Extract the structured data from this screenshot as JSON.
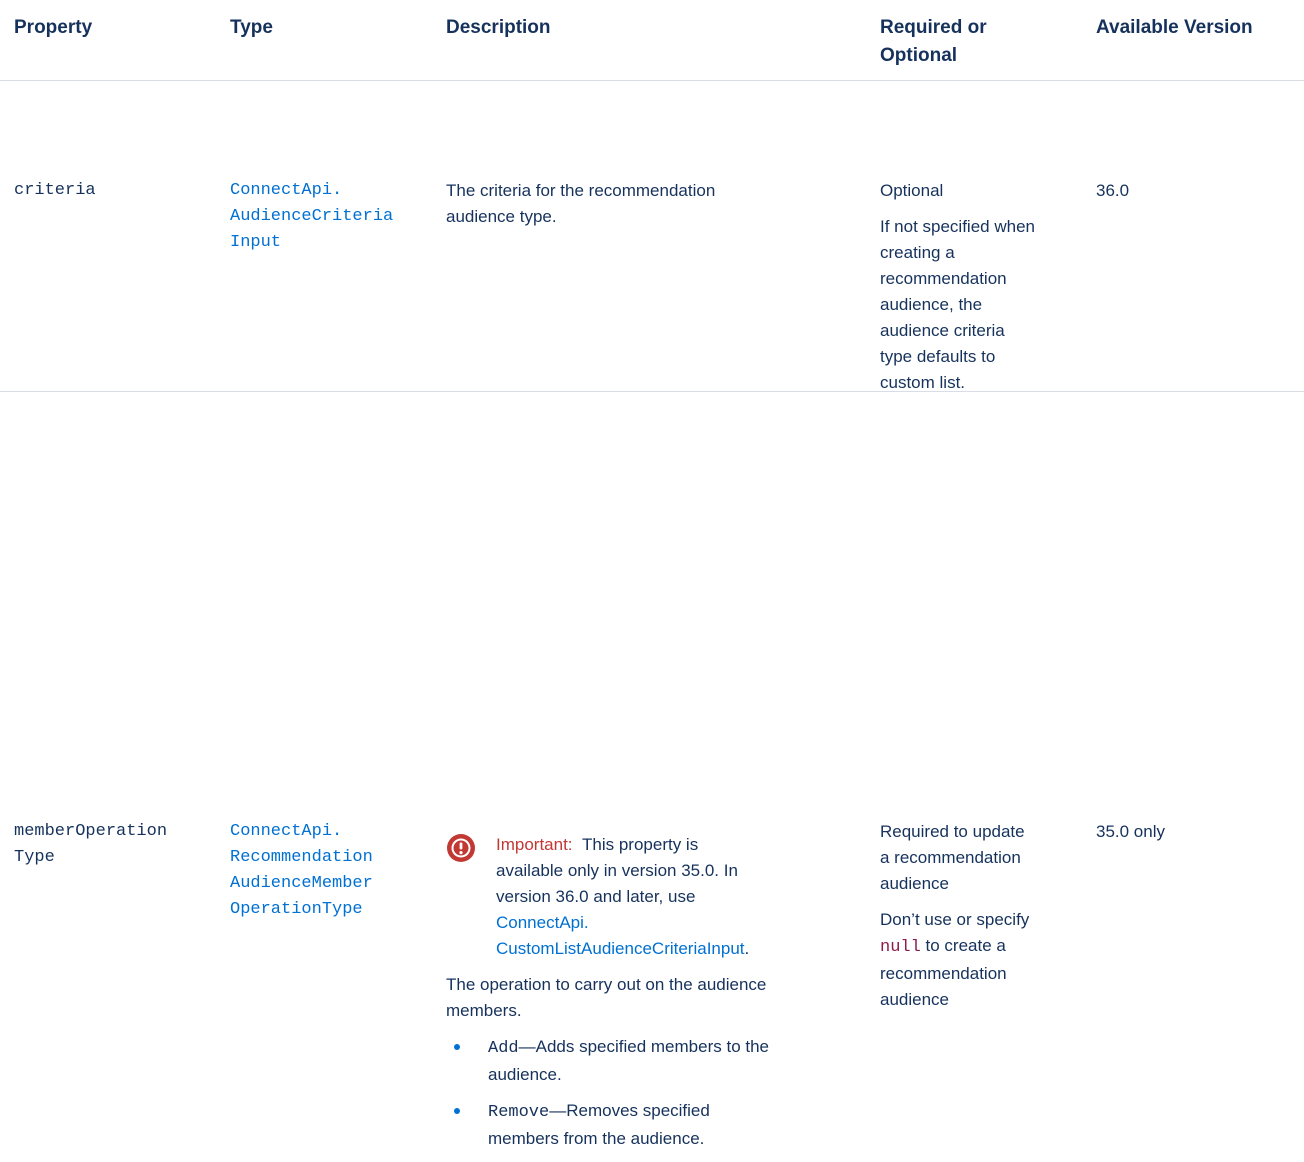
{
  "headers": {
    "property": "Property",
    "type": "Type",
    "description": "Description",
    "required_line1": "Required or",
    "required_line2": "Optional",
    "version": "Available Version"
  },
  "rows": [
    {
      "property_lines": [
        "criteria"
      ],
      "type_lines": [
        "ConnectApi.",
        "AudienceCriteria",
        "Input"
      ],
      "description_lines": [
        "The criteria for the recommendation",
        "audience type."
      ],
      "required_first_lines": [
        "Optional"
      ],
      "required_second_lines": [
        "If not specified when",
        "creating a",
        "recommendation",
        "audience, the",
        "audience criteria",
        "type defaults to",
        "custom list."
      ],
      "version": "36.0"
    },
    {
      "property_lines": [
        "memberOperation",
        "Type"
      ],
      "type_lines": [
        "ConnectApi.",
        "Recommendation",
        "AudienceMember",
        "OperationType"
      ],
      "important_label": "Important:",
      "important_lines": [
        "This property is",
        "available only in version 35.0. In",
        "version 36.0 and later, use"
      ],
      "important_link_lines": [
        "ConnectApi.",
        "CustomListAudienceCriteriaInput"
      ],
      "important_period": ".",
      "description_lines": [
        "The operation to carry out on the audience",
        "members."
      ],
      "bullets": [
        {
          "code": "Add",
          "text_lines": [
            "—Adds specified members to the",
            "audience."
          ]
        },
        {
          "code": "Remove",
          "text_lines": [
            "—Removes specified",
            "members from the audience."
          ]
        }
      ],
      "required_first_lines": [
        "Required to update",
        "a recommendation",
        "audience"
      ],
      "required_second_pre": "Don’t use or specify",
      "required_second_code": "null",
      "required_second_post": " to create a",
      "required_second_rest": [
        "recommendation",
        "audience"
      ],
      "version": "35.0 only"
    }
  ],
  "colors": {
    "text": "#16325c",
    "link": "#0070d2",
    "important": "#c23934",
    "code_null": "#8c1b4a",
    "divider": "#d8dde6"
  }
}
